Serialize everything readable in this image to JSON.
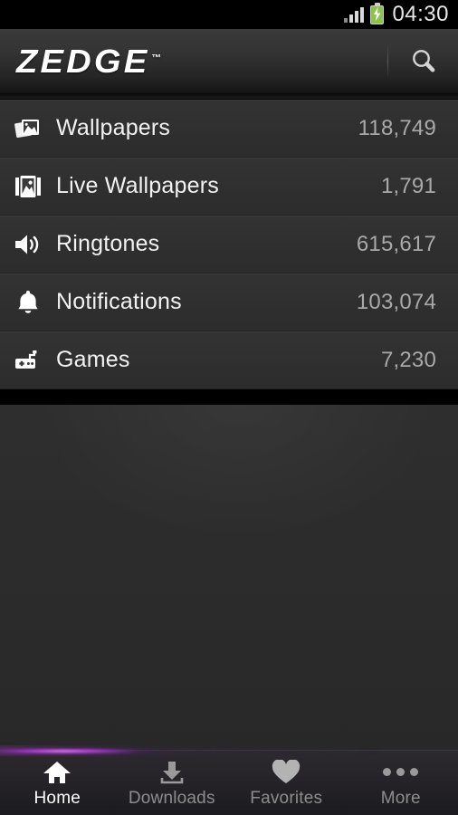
{
  "status_bar": {
    "time": "04:30",
    "signal_icon": "signal-bars-icon",
    "signal_bars": 4,
    "battery_icon": "battery-charging-icon",
    "battery_color": "#8bc34a"
  },
  "header": {
    "logo_text": "ZEDGE",
    "logo_trademark": "™",
    "search_icon": "search-icon"
  },
  "list": {
    "rows": [
      {
        "icon": "wallpapers-icon",
        "label": "Wallpapers",
        "count": "118,749"
      },
      {
        "icon": "live-wallpapers-icon",
        "label": "Live Wallpapers",
        "count": "1,791"
      },
      {
        "icon": "ringtones-icon",
        "label": "Ringtones",
        "count": "615,617"
      },
      {
        "icon": "notifications-icon",
        "label": "Notifications",
        "count": "103,074"
      },
      {
        "icon": "games-icon",
        "label": "Games",
        "count": "7,230"
      }
    ]
  },
  "tabbar": {
    "active_index": 0,
    "accent_color": "#c14fe0",
    "tabs": [
      {
        "icon": "home-icon",
        "label": "Home"
      },
      {
        "icon": "download-icon",
        "label": "Downloads"
      },
      {
        "icon": "heart-icon",
        "label": "Favorites"
      },
      {
        "icon": "more-dots-icon",
        "label": "More"
      }
    ]
  }
}
